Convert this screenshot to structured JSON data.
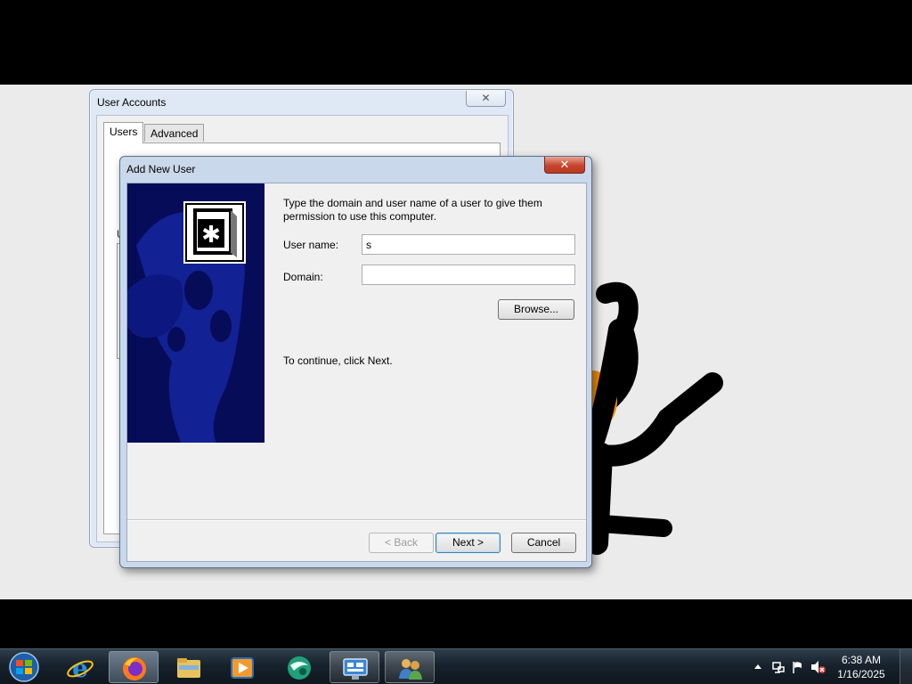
{
  "desktop": {
    "background_color": "#ebebeb",
    "wallpaper_figure": "stick-figure-illustration"
  },
  "user_accounts_window": {
    "title": "User Accounts",
    "close_label": "✕",
    "tabs": [
      {
        "label": "Users",
        "selected": true
      },
      {
        "label": "Advanced",
        "selected": false
      }
    ],
    "obscured_fragments": [
      "U"
    ]
  },
  "add_new_user_dialog": {
    "title": "Add New User",
    "close_label": "✕",
    "prompt": "Type the domain and user name of a user to give them permission to use this computer.",
    "username_label": "User name:",
    "username_value": "s",
    "domain_label": "Domain:",
    "domain_value": "",
    "browse_label": "Browse...",
    "continue_text": "To continue, click Next.",
    "back_label": "< Back",
    "next_label": "Next >",
    "cancel_label": "Cancel",
    "banner_color": "#060c58",
    "banner_icon": "users-key-icon"
  },
  "taskbar": {
    "items": [
      {
        "name": "start-button",
        "icon": "windows-orb-icon"
      },
      {
        "name": "internet-explorer",
        "icon": "internet-explorer-icon"
      },
      {
        "name": "firefox",
        "icon": "firefox-icon",
        "state": "active"
      },
      {
        "name": "windows-explorer",
        "icon": "folder-icon"
      },
      {
        "name": "media-player",
        "icon": "media-player-icon"
      },
      {
        "name": "app-sphere",
        "icon": "sphere-app-icon"
      },
      {
        "name": "control-panel",
        "icon": "control-panel-icon",
        "state": "open"
      },
      {
        "name": "user-accounts",
        "icon": "user-accounts-icon",
        "state": "open"
      }
    ],
    "tray": {
      "icons": [
        "show-hidden-icons-arrow",
        "network-icon",
        "action-center-flag-icon",
        "volume-muted-icon"
      ],
      "time": "6:38 AM",
      "date": "1/16/2025"
    }
  }
}
